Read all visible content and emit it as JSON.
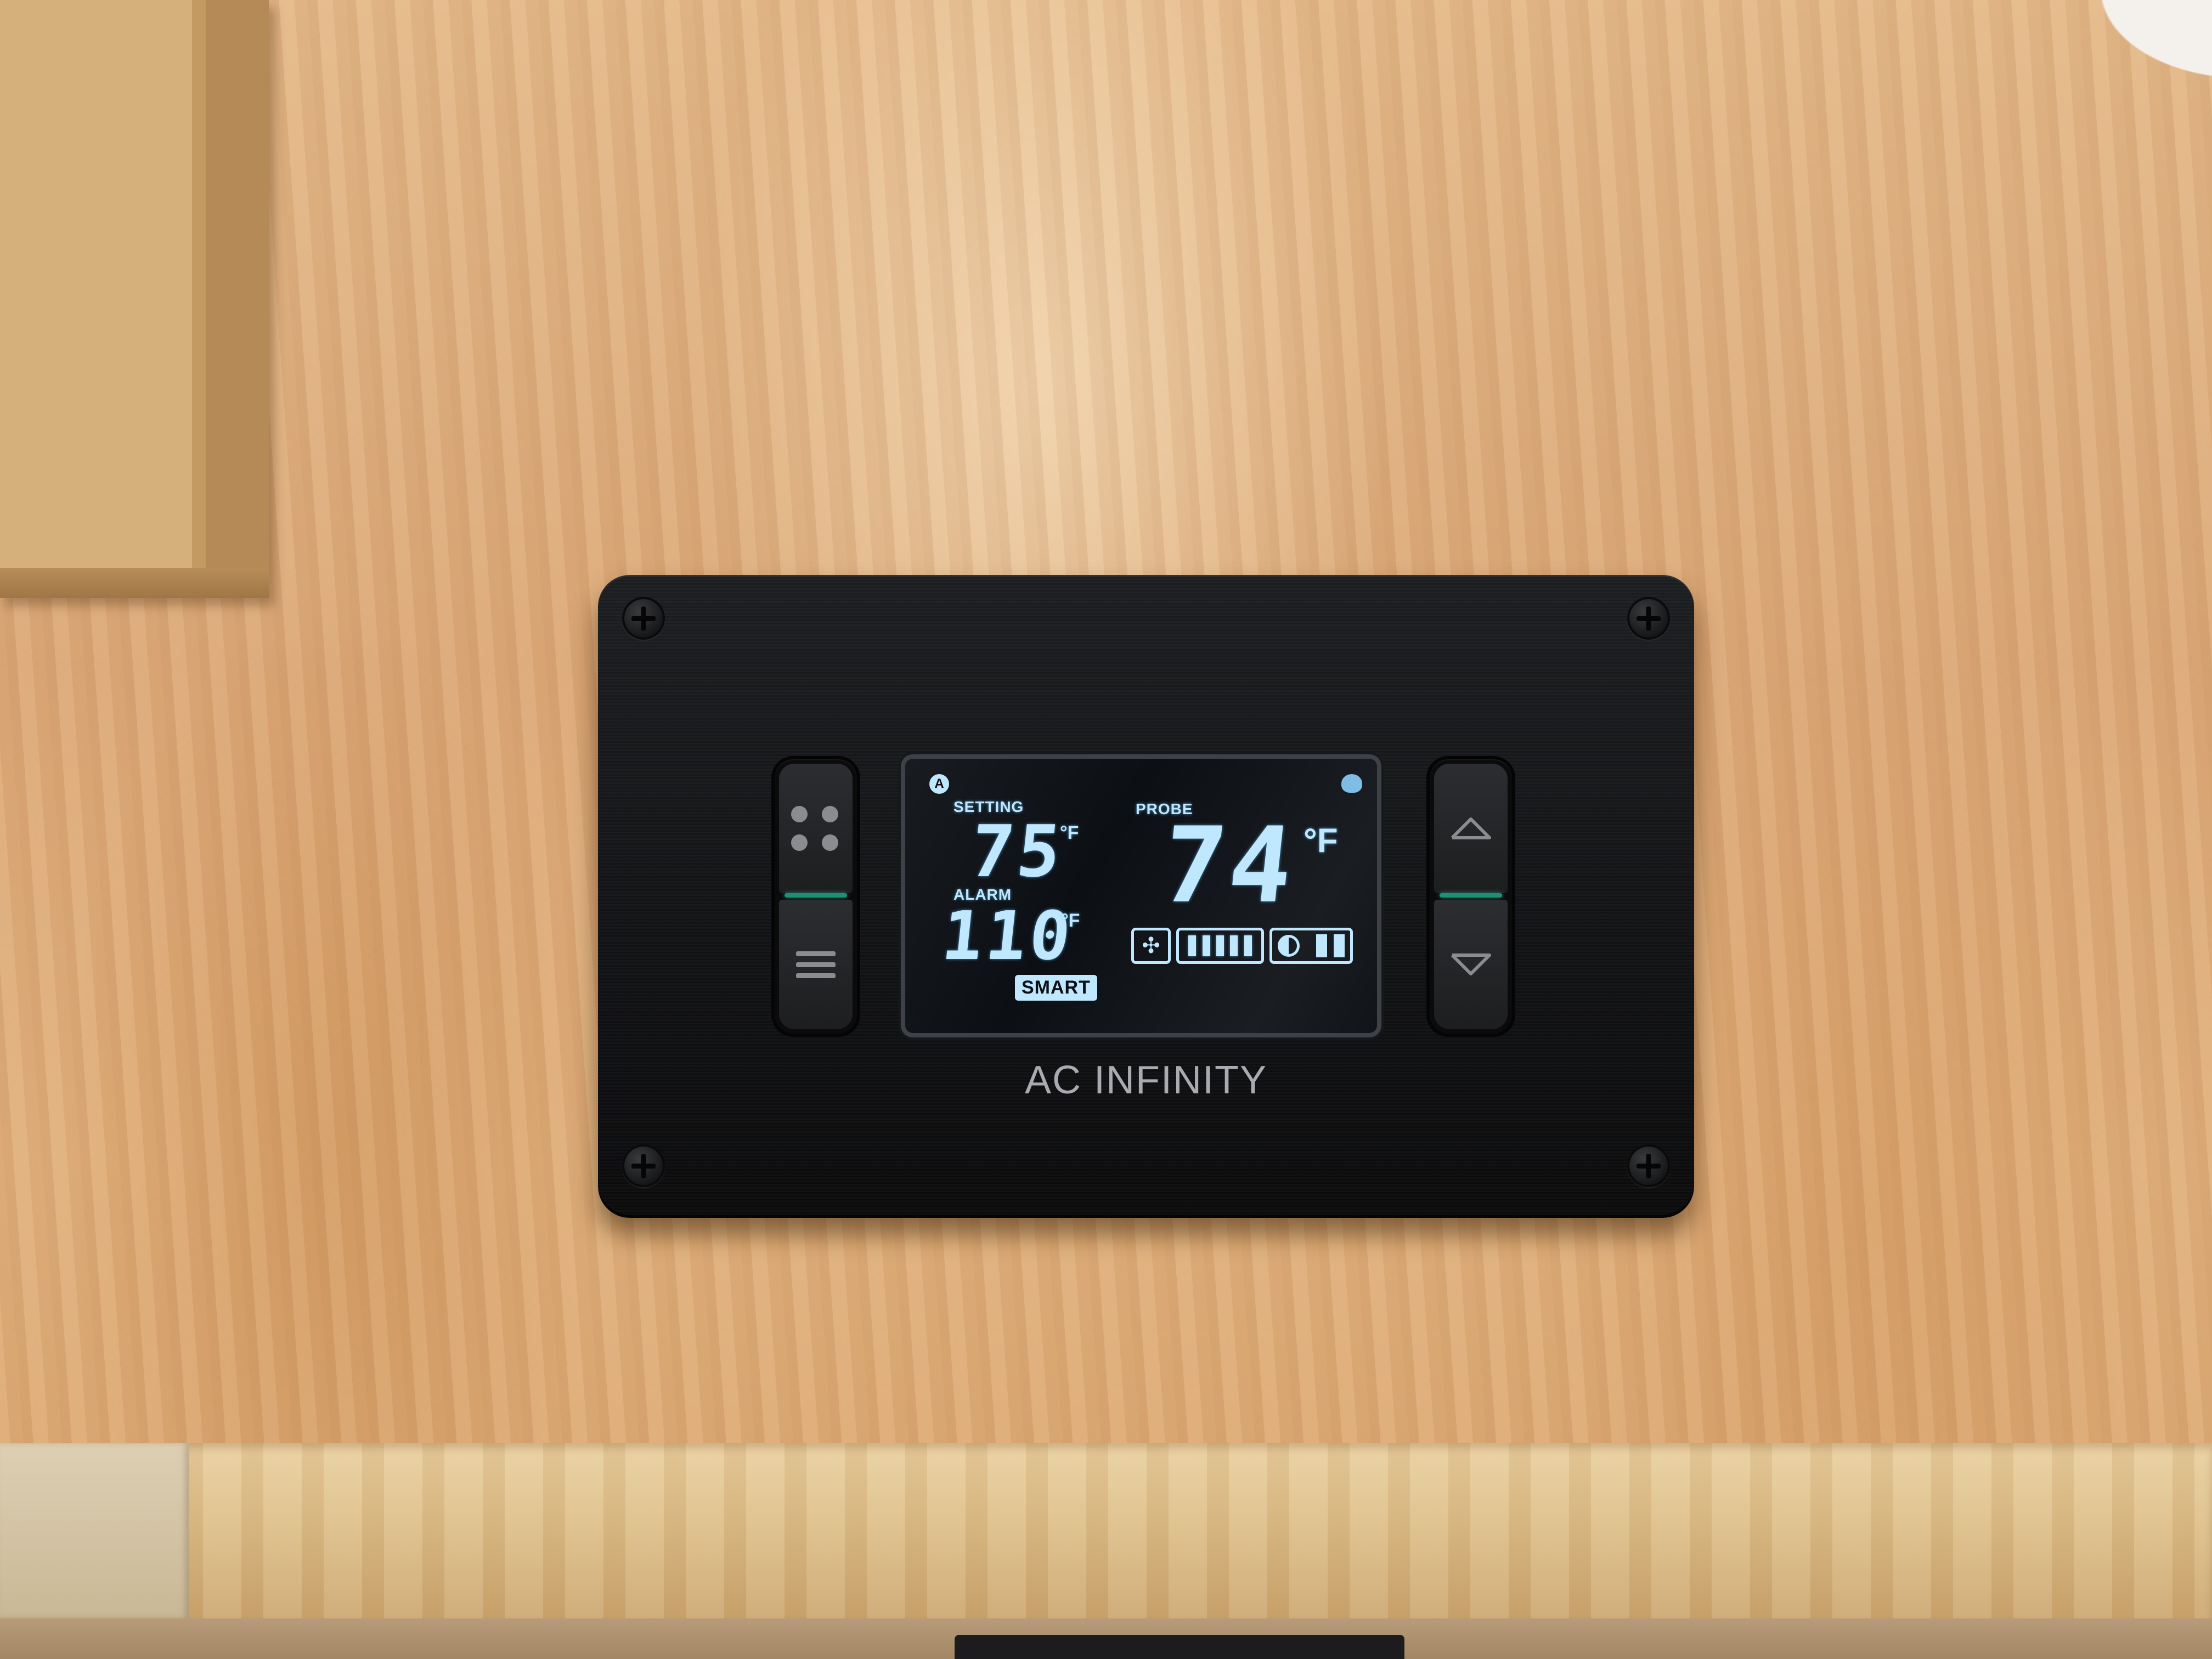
{
  "device": {
    "brand": "AC INFINITY",
    "display": {
      "setting_label": "SETTING",
      "setting_value": "75",
      "setting_unit": "°F",
      "alarm_label": "ALARM",
      "alarm_value": "110",
      "alarm_unit": "°F",
      "probe_label": "PROBE",
      "probe_value": "74",
      "probe_unit": "°F",
      "auto_badge": "A",
      "mode_badge": "SMART",
      "fan_level_bars": 5
    },
    "buttons": {
      "left_top_icon": "four-dots-icon",
      "left_bottom_icon": "menu-lines-icon",
      "right_top_icon": "arrow-up-icon",
      "right_bottom_icon": "arrow-down-icon"
    },
    "colors": {
      "lcd_text": "#bfe8ff",
      "indicator_strip": "#1f8f76"
    }
  }
}
